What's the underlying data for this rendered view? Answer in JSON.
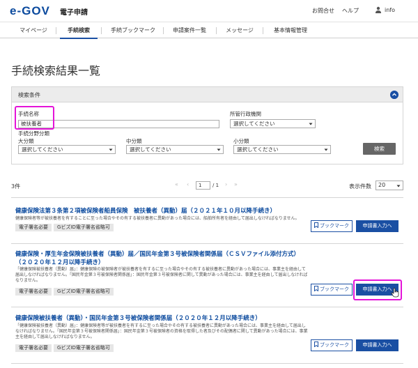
{
  "header": {
    "logo": "e-GOV",
    "service": "電子申請",
    "contact": "お問合せ",
    "help": "ヘルプ",
    "user": "info"
  },
  "nav": {
    "items": [
      "マイページ",
      "手続検索",
      "手続ブックマーク",
      "申請案件一覧",
      "メッセージ",
      "基本情報管理"
    ],
    "active": "手続検索"
  },
  "page_title": "手続検索結果一覧",
  "search": {
    "panel_label": "検索条件",
    "proc_name_label": "手続名称",
    "proc_name_value": "被扶養者",
    "agency_label": "所管行政機関",
    "field_label": "手続分野分類",
    "large_label": "大分類",
    "mid_label": "中分類",
    "small_label": "小分類",
    "select_placeholder": "選択してください",
    "search_button": "検索"
  },
  "results_bar": {
    "count": "3件",
    "first": "«",
    "prev": "‹",
    "page": "1",
    "total": "/ 1",
    "next": "›",
    "last": "»",
    "per_page_label": "表示件数",
    "per_page_value": "20"
  },
  "results": [
    {
      "title": "健康保険法第３条第２項被保険者船員保険　被扶養者（異動）届（２０２１年１０月以降手続き）",
      "desc": "健康保険者等が被扶養者を有することに至った場合やその有する被扶養者に異動があった場合には、船舶所有者を経由して届出しなければなりません。",
      "tags": [
        "電子署名必要",
        "GビズID電子署名省略可"
      ],
      "bookmark": "ブックマーク",
      "apply": "申請書入力へ"
    },
    {
      "title": "健康保険・厚生年金保険被扶養者（異動）届／国民年金第３号被保険者関係届（ＣＳＶファイル添付方式）（２０２０年１２月以降手続き）",
      "desc": "「健康保険被扶養者（異動）届」：健康保険の被保険者が被扶養者を有するに至った場合やその有する被扶養者に異動があった場合には、事業主を経由して届出しなければなりません。「国民年金第３号被保険者関係届」：国民年金第３号被保険者に関して異動があった場合には、事業主を経由して届出しなければなりません。",
      "tags": [
        "電子署名必要",
        "GビズID電子署名省略可"
      ],
      "bookmark": "ブックマーク",
      "apply": "申請書入力へ"
    },
    {
      "title": "健康保険被扶養者（異動）・国民年金第３号被保険者関係届（２０２０年１２月以降手続き）",
      "desc": "「健康保険被扶養者（異動）届」：健康保険者等が被扶養者を有するに至った場合やその有する被扶養者に異動があった場合には、事業主を経由して届出しなければなりません。「国民年金第３号被保険者関係届」：国民年金第３号被保険者の資格を取得した者及びその配偶者に関して異動があった場合には、事業主を経由して届出しなければなりません。",
      "tags": [
        "電子署名必要",
        "GビズID電子署名省略可"
      ],
      "bookmark": "ブックマーク",
      "apply": "申請書入力へ"
    }
  ],
  "colors": {
    "brand": "#0b4a9e",
    "button": "#1a4fa3",
    "highlight": "#e414d8"
  }
}
